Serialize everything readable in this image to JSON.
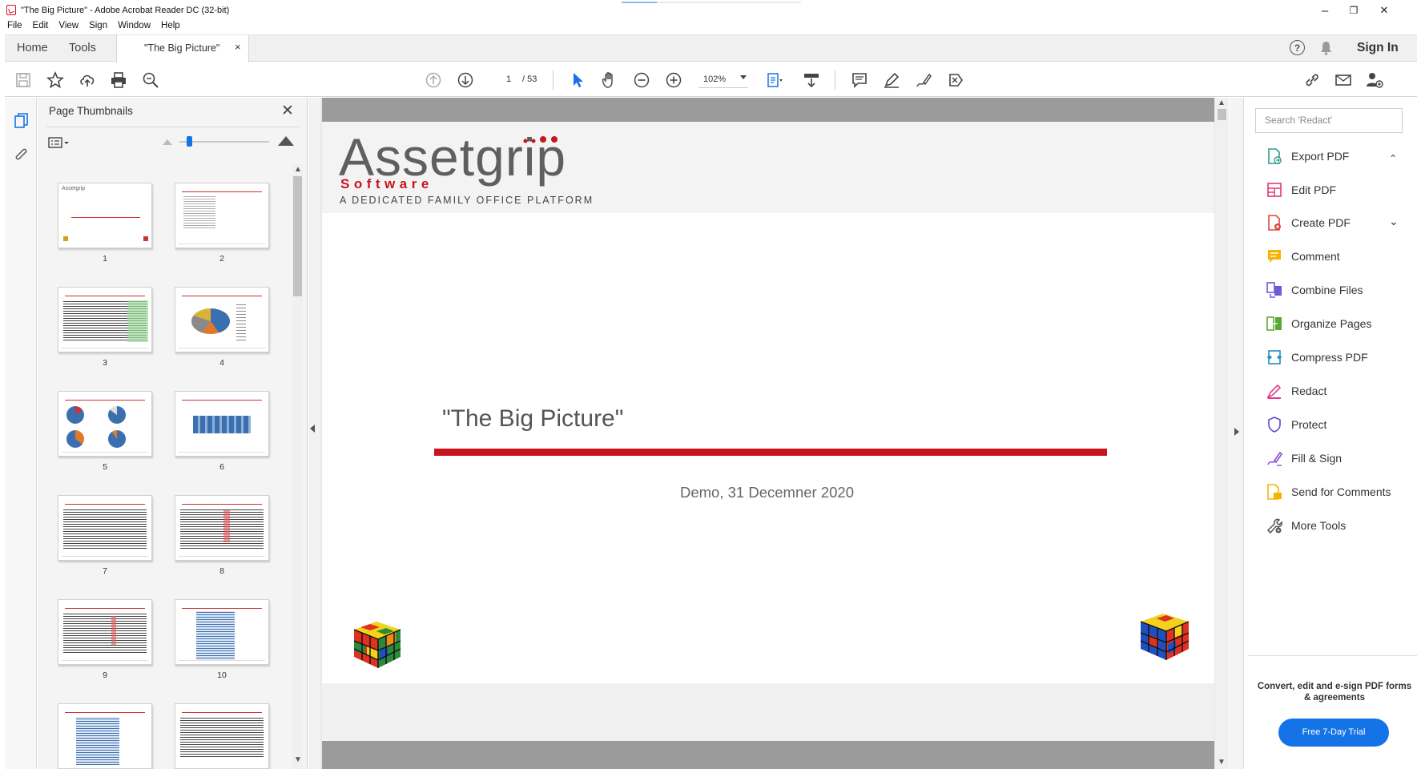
{
  "window": {
    "title": "\"The Big Picture\" - Adobe Acrobat Reader DC (32-bit)",
    "minimize": "–",
    "restore": "❐",
    "close": "✕"
  },
  "menu": [
    "File",
    "Edit",
    "View",
    "Sign",
    "Window",
    "Help"
  ],
  "tabs": {
    "home": "Home",
    "tools": "Tools",
    "document": "\"The Big Picture\"",
    "close": "×",
    "sign_in": "Sign In",
    "help": "?"
  },
  "toolbar": {
    "page_current": "1",
    "page_total": "/ 53",
    "zoom": "102%"
  },
  "thumbnails": {
    "title": "Page Thumbnails",
    "close": "✕",
    "pages": [
      "1",
      "2",
      "3",
      "4",
      "5",
      "6",
      "7",
      "8",
      "9",
      "10"
    ]
  },
  "document": {
    "logo_main": "Assetgrip",
    "logo_software": "Software",
    "logo_tagline": "A DEDICATED FAMILY OFFICE PLATFORM",
    "title": "\"The Big Picture\"",
    "subtitle": "Demo,  31 Decemner 2020"
  },
  "tools_pane": {
    "search_placeholder": "Search 'Redact'",
    "items": [
      {
        "label": "Export PDF",
        "color": "#2d9b8f"
      },
      {
        "label": "Edit PDF",
        "color": "#e2386b"
      },
      {
        "label": "Create PDF",
        "color": "#e0453a"
      },
      {
        "label": "Comment",
        "color": "#f5b400"
      },
      {
        "label": "Combine Files",
        "color": "#6b5bd6"
      },
      {
        "label": "Organize Pages",
        "color": "#5aa832"
      },
      {
        "label": "Compress PDF",
        "color": "#1f8bc4"
      },
      {
        "label": "Redact",
        "color": "#e23b8a"
      },
      {
        "label": "Protect",
        "color": "#5b4dc9"
      },
      {
        "label": "Fill & Sign",
        "color": "#8a4ed6"
      },
      {
        "label": "Send for Comments",
        "color": "#f5b400"
      },
      {
        "label": "More Tools",
        "color": "#555555"
      }
    ],
    "promo": "Convert, edit and e-sign PDF forms & agreements",
    "trial_button": "Free 7-Day Trial"
  },
  "colors": {
    "accent": "#1473e6",
    "brand_red": "#c8141e"
  }
}
